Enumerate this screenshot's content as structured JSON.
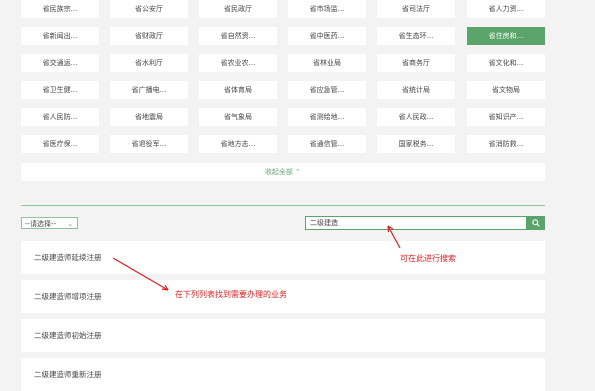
{
  "departments": [
    [
      "省民族宗...",
      "省公安厅",
      "省民政厅",
      "省市场监...",
      "省司法厅",
      "省人力资..."
    ],
    [
      "省新闻出...",
      "省财政厅",
      "省自然资...",
      "省中医药...",
      "省生态环...",
      "省住房和..."
    ],
    [
      "省交通运...",
      "省水利厅",
      "省农业农...",
      "省林业局",
      "省商务厅",
      "省文化和..."
    ],
    [
      "省卫生健...",
      "省广播电...",
      "省体育局",
      "省应急管...",
      "省统计局",
      "省文物局"
    ],
    [
      "省人民防...",
      "省地震局",
      "省气象局",
      "省测绘地...",
      "省人民政...",
      "省知识产..."
    ],
    [
      "省医疗保...",
      "省退役军...",
      "省地方志...",
      "省通信管...",
      "国家税务...",
      "省消防救..."
    ]
  ],
  "active_department": "省住房和...",
  "collapse_label": "收起全部",
  "collapse_icon": "chevron-up-icon",
  "filter": {
    "selected": "--请选择--",
    "icon": "chevron-down-icon"
  },
  "search": {
    "value": "二级建造",
    "icon": "search-icon"
  },
  "services": [
    "二级建造师延续注册",
    "二级建造师增项注册",
    "二级建造师初始注册",
    "二级建造师重新注册"
  ],
  "annotations": {
    "search_hint": "可在此进行搜索",
    "list_hint": "在下列列表找到需要办理的业务"
  },
  "colors": {
    "accent": "#5aa36a",
    "annotation": "#e01e1e",
    "background": "#f3f3f3"
  }
}
